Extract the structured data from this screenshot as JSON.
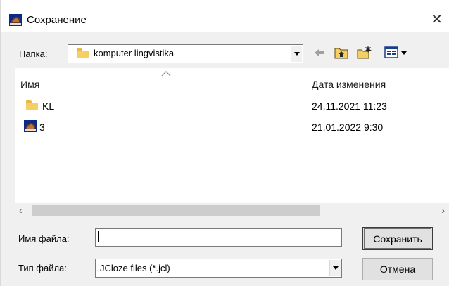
{
  "window": {
    "title": "Сохранение",
    "close_glyph": "✕",
    "app_icon": "jcloze-app-icon"
  },
  "location": {
    "label": "Папка:",
    "value": "komputer lingvistika",
    "icon": "folder-icon"
  },
  "toolbar": {
    "back_icon": "back-arrow-icon",
    "up_icon": "folder-up-icon",
    "new_folder_icon": "new-folder-icon",
    "view_menu_icon": "view-menu-icon"
  },
  "file_list": {
    "columns": [
      "Имя",
      "Дата изменения"
    ],
    "rows": [
      {
        "name": "KL",
        "date": "24.11.2021 11:23",
        "icon": "folder-icon"
      },
      {
        "name": "3",
        "date": "21.01.2022 9:30",
        "icon": "jcloze-file-icon"
      }
    ],
    "scroll_left": "‹",
    "scroll_right": "›"
  },
  "filename": {
    "label": "Имя файла:",
    "value": ""
  },
  "filetype": {
    "label": "Тип файла:",
    "value": "JCloze files (*.jcl)"
  },
  "buttons": {
    "save": "Сохранить",
    "cancel": "Отмена"
  },
  "colors": {
    "window_bg": "#f0f0f0",
    "folder": "#f6cf63",
    "button_bg": "#e1e1e1"
  }
}
